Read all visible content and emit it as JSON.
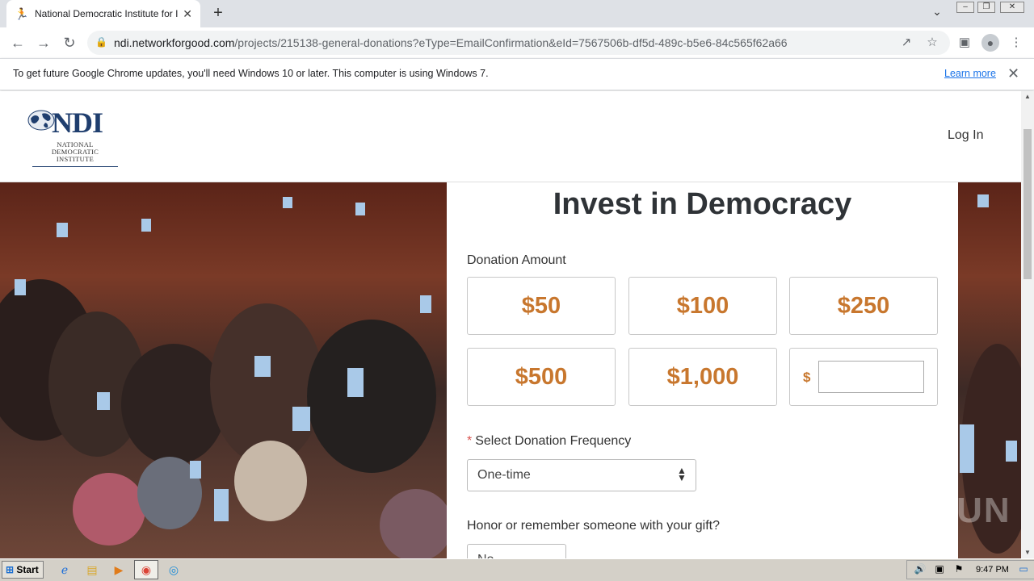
{
  "browser": {
    "tab_title": "National Democratic Institute for Int",
    "url_host": "ndi.networkforgood.com",
    "url_path": "/projects/215138-general-donations?eType=EmailConfirmation&eId=7567506b-df5d-489c-b5e6-84c565f62a66",
    "infobar_text": "To get future Google Chrome updates, you'll need Windows 10 or later. This computer is using Windows 7.",
    "infobar_link": "Learn more"
  },
  "site": {
    "logo_mark": "NDI",
    "logo_sub_1": "NATIONAL",
    "logo_sub_2": "DEMOCRATIC",
    "logo_sub_3": "INSTITUTE",
    "login_label": "Log In"
  },
  "form": {
    "heading": "Invest in Democracy",
    "amount_label": "Donation Amount",
    "amounts": [
      "$50",
      "$100",
      "$250",
      "$500",
      "$1,000"
    ],
    "custom_symbol": "$",
    "custom_value": "",
    "frequency_label": "Select Donation Frequency",
    "frequency_required_mark": "*",
    "frequency_value": "One-time",
    "honor_label": "Honor or remember someone with your gift?",
    "honor_value": "No"
  },
  "watermark": "ANY RUN",
  "taskbar": {
    "start_label": "Start",
    "clock": "9:47 PM"
  },
  "colors": {
    "accent_amount": "#c8772e",
    "logo_blue": "#1f3e6e",
    "link_blue": "#1a73e8"
  }
}
